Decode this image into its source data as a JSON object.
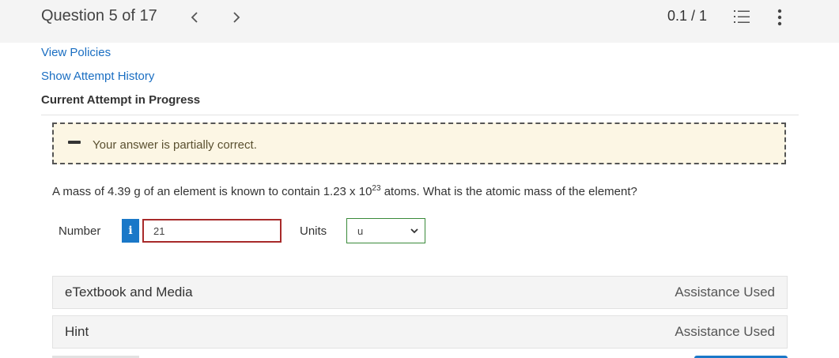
{
  "header": {
    "question_label": "Question 5 of 17",
    "prev_icon": "chevron-left-icon",
    "next_icon": "chevron-right-icon",
    "score": "0.1 / 1",
    "list_icon": "numbered-list-icon",
    "more_icon": "vertical-dots-icon"
  },
  "links": {
    "view_policies": "View Policies",
    "show_attempt_history": "Show Attempt History"
  },
  "attempt_status": "Current Attempt in Progress",
  "feedback": {
    "icon": "partial-minus-icon",
    "text": "Your answer is partially correct."
  },
  "question": {
    "text_before": "A mass of 4.39 g of an element is known to contain 1.23 x 10",
    "exponent": "23",
    "text_after": " atoms. What is the atomic mass of the element?"
  },
  "answer": {
    "number_label": "Number",
    "info_label": "i",
    "number_value": "21",
    "units_label": "Units",
    "units_selected": "u"
  },
  "resources": [
    {
      "title": "eTextbook and Media",
      "status": "Assistance Used"
    },
    {
      "title": "Hint",
      "status": "Assistance Used"
    }
  ],
  "colors": {
    "link": "#1a6ec2",
    "feedback_bg": "#fcf6e4",
    "info_button": "#1a78c8",
    "input_border": "#a82a2a",
    "select_border": "#3a8a3a"
  }
}
